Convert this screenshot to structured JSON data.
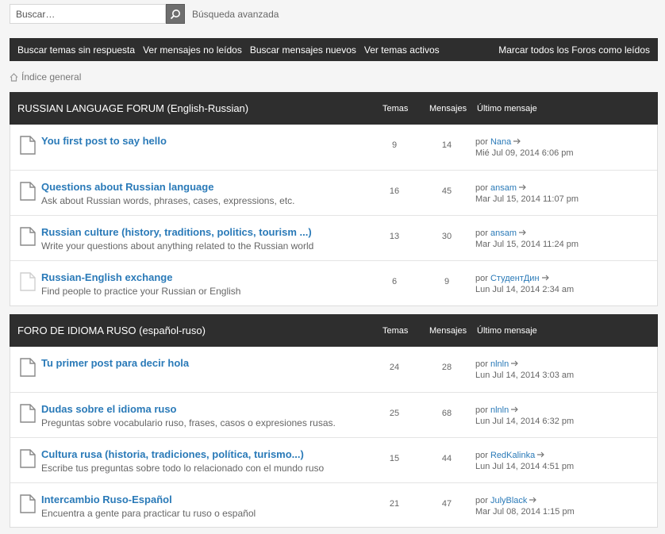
{
  "search": {
    "placeholder": "Buscar…",
    "advanced_label": "Búsqueda avanzada"
  },
  "nav": {
    "items": [
      {
        "label": "Buscar temas sin respuesta"
      },
      {
        "label": "Ver mensajes no leídos"
      },
      {
        "label": "Buscar mensajes nuevos"
      },
      {
        "label": "Ver temas activos"
      }
    ],
    "mark_all": "Marcar todos los Foros como leídos"
  },
  "breadcrumb": {
    "home": "Índice general"
  },
  "categories": [
    {
      "title": "RUSSIAN LANGUAGE FORUM (English-Russian)",
      "col_topics": "Temas",
      "col_posts": "Mensajes",
      "col_last": "Último mensaje",
      "forums": [
        {
          "title": "You first post to say hello",
          "desc": "",
          "topics": "9",
          "posts": "14",
          "by": "por",
          "user": "Nana",
          "date": "Mié Jul 09, 2014 6:06 pm",
          "unread": true
        },
        {
          "title": "Questions about Russian language",
          "desc": "Ask about Russian words, phrases, cases, expressions, etc.",
          "topics": "16",
          "posts": "45",
          "by": "por",
          "user": "ansam",
          "date": "Mar Jul 15, 2014 11:07 pm",
          "unread": true
        },
        {
          "title": "Russian culture (history, traditions, politics, tourism ...)",
          "desc": "Write your questions about anything related to the Russian world",
          "topics": "13",
          "posts": "30",
          "by": "por",
          "user": "ansam",
          "date": "Mar Jul 15, 2014 11:24 pm",
          "unread": true
        },
        {
          "title": "Russian-English exchange",
          "desc": "Find people to practice your Russian or English",
          "topics": "6",
          "posts": "9",
          "by": "por",
          "user": "СтудентДин",
          "date": "Lun Jul 14, 2014 2:34 am",
          "unread": false
        }
      ]
    },
    {
      "title": "FORO DE IDIOMA RUSO (español-ruso)",
      "col_topics": "Temas",
      "col_posts": "Mensajes",
      "col_last": "Último mensaje",
      "forums": [
        {
          "title": "Tu primer post para decir hola",
          "desc": "",
          "topics": "24",
          "posts": "28",
          "by": "por",
          "user": "nlnln",
          "date": "Lun Jul 14, 2014 3:03 am",
          "unread": true
        },
        {
          "title": "Dudas sobre el idioma ruso",
          "desc": "Preguntas sobre vocabulario ruso, frases, casos o expresiones rusas.",
          "topics": "25",
          "posts": "68",
          "by": "por",
          "user": "nlnln",
          "date": "Lun Jul 14, 2014 6:32 pm",
          "unread": true
        },
        {
          "title": "Cultura rusa (historia, tradiciones, política, turismo...)",
          "desc": "Escribe tus preguntas sobre todo lo relacionado con el mundo ruso",
          "topics": "15",
          "posts": "44",
          "by": "por",
          "user": "RedKalinka",
          "date": "Lun Jul 14, 2014 4:51 pm",
          "unread": true
        },
        {
          "title": "Intercambio Ruso-Español",
          "desc": "Encuentra a gente para practicar tu ruso o español",
          "topics": "21",
          "posts": "47",
          "by": "por",
          "user": "JulyBlack",
          "date": "Mar Jul 08, 2014 1:15 pm",
          "unread": true
        }
      ]
    }
  ],
  "colors": {
    "dark_bar": "#2e2e2e",
    "link": "#2a7ab8",
    "background": "#f5f5f5"
  },
  "icons": {
    "search": "magnifier-icon",
    "home": "home-icon",
    "forum": "document-icon",
    "goto": "arrow-right-icon"
  }
}
